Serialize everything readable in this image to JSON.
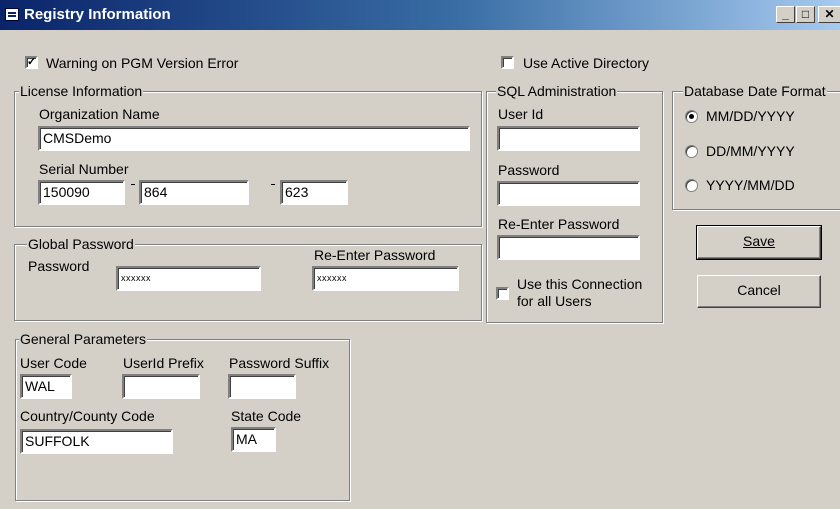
{
  "window": {
    "title": "Registry Information",
    "icon": "window-icon"
  },
  "caption_buttons": {
    "minimize": "_",
    "maximize": "□",
    "close": "✕"
  },
  "options": {
    "warning_pgm_label": "Warning on PGM Version Error",
    "warning_pgm_checked": true,
    "active_directory_label": "Use Active Directory",
    "active_directory_checked": false
  },
  "license": {
    "group_label": "License Information",
    "org_label": "Organization Name",
    "org_value": "CMSDemo",
    "serial_label": "Serial Number",
    "serial_part1": "150090",
    "serial_part2": "864",
    "serial_part3": "623"
  },
  "global_password": {
    "group_label": "Global Password",
    "password_label": "Password",
    "password_value": "xxxxxx",
    "reenter_label": "Re-Enter Password",
    "reenter_value": "xxxxxx"
  },
  "sql": {
    "group_label": "SQL Administration",
    "user_id_label": "User Id",
    "user_id_value": "",
    "password_label": "Password",
    "password_value": "",
    "reenter_label": "Re-Enter Password",
    "reenter_value": "",
    "all_users_label_line1": "Use this Connection",
    "all_users_label_line2": "for all Users",
    "all_users_checked": false
  },
  "date_format": {
    "group_label": "Database Date Format",
    "options": [
      "MM/DD/YYYY",
      "DD/MM/YYYY",
      "YYYY/MM/DD"
    ],
    "selected": "MM/DD/YYYY"
  },
  "buttons": {
    "save": "Save",
    "cancel": "Cancel"
  },
  "general": {
    "group_label": "General Parameters",
    "user_code_label": "User Code",
    "user_code_value": "WAL",
    "userid_prefix_label": "UserId Prefix",
    "userid_prefix_value": "",
    "password_suffix_label": "Password Suffix",
    "password_suffix_value": "",
    "country_label": "Country/County Code",
    "country_value": "SUFFOLK",
    "state_label": "State Code",
    "state_value": "MA"
  }
}
